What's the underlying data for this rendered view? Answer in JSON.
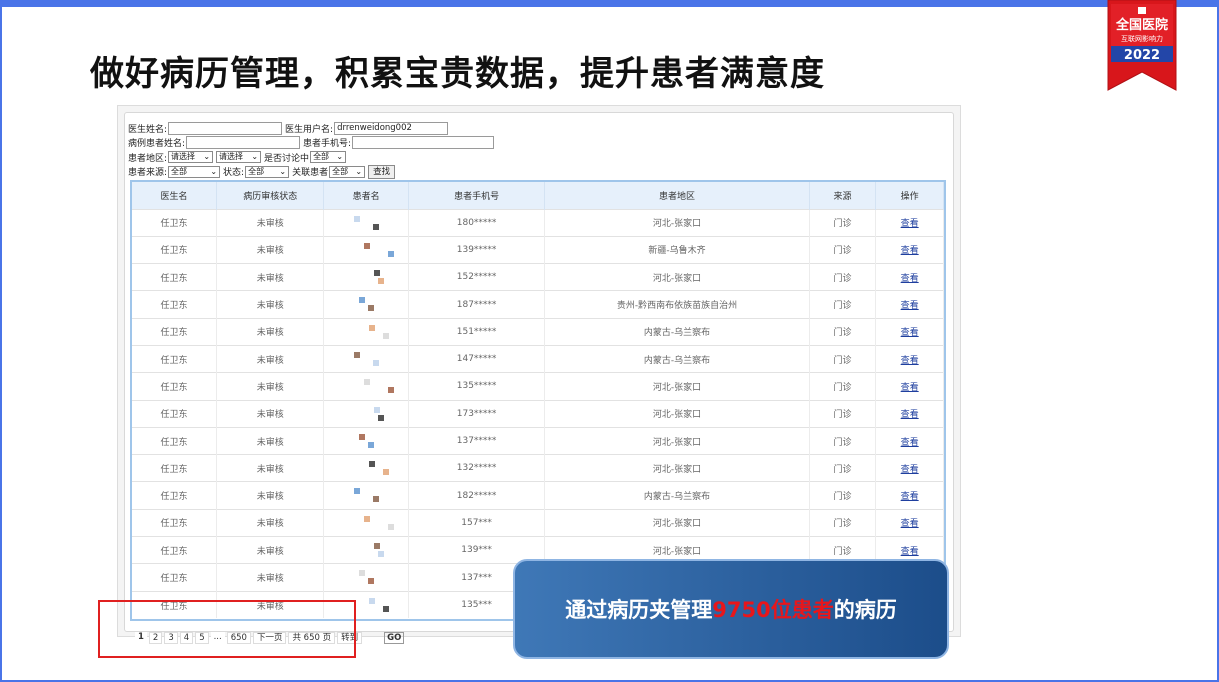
{
  "slide": {
    "title": "做好病历管理，积累宝贵数据，提升患者满意度",
    "badge": {
      "line1": "全国医院",
      "line2": "互联网影响力",
      "year": "2022"
    },
    "callout": {
      "prefix": "通过病历夹管理",
      "highlight": "9750位患者",
      "suffix": "的病历"
    }
  },
  "form": {
    "doctor_name_label": "医生姓名:",
    "doctor_name_value": "",
    "doctor_user_label": "医生用户名:",
    "doctor_user_value": "drrenweidong002",
    "patient_name_label": "病例患者姓名:",
    "patient_name_value": "",
    "patient_phone_label": "患者手机号:",
    "patient_phone_value": "",
    "region_label": "患者地区:",
    "region_select1": "请选择",
    "region_select2": "请选择",
    "discussing_label": "是否讨论中",
    "discussing_value": "全部",
    "source_label": "患者来源:",
    "source_value": "全部",
    "status_label": "状态:",
    "status_value": "全部",
    "related_label": "关联患者",
    "related_value": "全部",
    "search_button": "查找"
  },
  "table": {
    "headers": [
      "医生名",
      "病历审核状态",
      "患者名",
      "患者手机号",
      "患者地区",
      "来源",
      "操作"
    ],
    "rows": [
      {
        "doctor": "任卫东",
        "status": "未审核",
        "phone": "180*****",
        "region": "河北-张家口",
        "source": "门诊",
        "action": "查看"
      },
      {
        "doctor": "任卫东",
        "status": "未审核",
        "phone": "139*****",
        "region": "新疆-乌鲁木齐",
        "source": "门诊",
        "action": "查看"
      },
      {
        "doctor": "任卫东",
        "status": "未审核",
        "phone": "152*****",
        "region": "河北-张家口",
        "source": "门诊",
        "action": "查看"
      },
      {
        "doctor": "任卫东",
        "status": "未审核",
        "phone": "187*****",
        "region": "贵州-黔西南布依族苗族自治州",
        "source": "门诊",
        "action": "查看"
      },
      {
        "doctor": "任卫东",
        "status": "未审核",
        "phone": "151*****",
        "region": "内蒙古-乌兰察布",
        "source": "门诊",
        "action": "查看"
      },
      {
        "doctor": "任卫东",
        "status": "未审核",
        "phone": "147*****",
        "region": "内蒙古-乌兰察布",
        "source": "门诊",
        "action": "查看"
      },
      {
        "doctor": "任卫东",
        "status": "未审核",
        "phone": "135*****",
        "region": "河北-张家口",
        "source": "门诊",
        "action": "查看"
      },
      {
        "doctor": "任卫东",
        "status": "未审核",
        "phone": "173*****",
        "region": "河北-张家口",
        "source": "门诊",
        "action": "查看"
      },
      {
        "doctor": "任卫东",
        "status": "未审核",
        "phone": "137*****",
        "region": "河北-张家口",
        "source": "门诊",
        "action": "查看"
      },
      {
        "doctor": "任卫东",
        "status": "未审核",
        "phone": "132*****",
        "region": "河北-张家口",
        "source": "门诊",
        "action": "查看"
      },
      {
        "doctor": "任卫东",
        "status": "未审核",
        "phone": "182*****",
        "region": "内蒙古-乌兰察布",
        "source": "门诊",
        "action": "查看"
      },
      {
        "doctor": "任卫东",
        "status": "未审核",
        "phone": "157***",
        "region": "河北-张家口",
        "source": "门诊",
        "action": "查看"
      },
      {
        "doctor": "任卫东",
        "status": "未审核",
        "phone": "139***",
        "region": "河北-张家口",
        "source": "门诊",
        "action": "查看"
      },
      {
        "doctor": "任卫东",
        "status": "未审核",
        "phone": "137***",
        "region": "",
        "source": "",
        "action": ""
      },
      {
        "doctor": "任卫东",
        "status": "未审核",
        "phone": "135***",
        "region": "",
        "source": "",
        "action": ""
      }
    ]
  },
  "pager": {
    "pages": [
      "1",
      "2",
      "3",
      "4",
      "5",
      "...",
      "650"
    ],
    "next": "下一页",
    "total": "共 650 页",
    "goto": "转到",
    "go": "GO"
  },
  "colors": {
    "frame": "#4a74e8",
    "highlight": "#e8161b",
    "callout_bg": "#2a5c9c",
    "red_box": "#e02020"
  }
}
